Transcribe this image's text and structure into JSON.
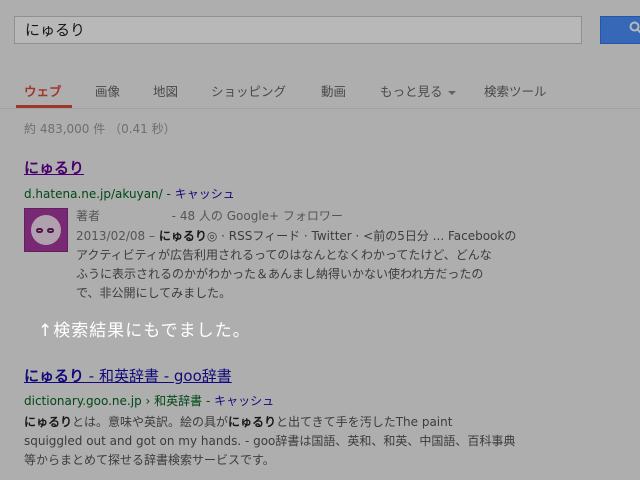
{
  "search": {
    "query": "にゅるり"
  },
  "tabs": [
    {
      "label": "ウェブ"
    },
    {
      "label": "画像"
    },
    {
      "label": "地図"
    },
    {
      "label": "ショッピング"
    },
    {
      "label": "動画"
    },
    {
      "label": "もっと見る"
    },
    {
      "label": "検索ツール"
    }
  ],
  "stats": "約 483,000 件 （0.41 秒）",
  "results": [
    {
      "title": "にゅるり",
      "url": "d.hatena.ne.jp/akuyan/",
      "cache": "キャッシュ",
      "author_label": "著者",
      "author_followers": "- 48 人の Google+ フォロワー",
      "snippet_lines": [
        {
          "date": "2013/02/08 –",
          "bold": "にゅるり",
          "text": "◎ · RSSフィード · Twitter · <前の5日分 ... Facebookの"
        },
        {
          "text": "アクティビティが広告利用されるってのはなんとなくわかってたけど、どんな"
        },
        {
          "text": "ふうに表示されるのかがわかった＆あんまし納得いかない使われ方だったの"
        },
        {
          "text": "で、非公開にしてみました。"
        }
      ]
    },
    {
      "title_bold": "にゅるり",
      "title_rest": " - 和英辞書 - goo辞書",
      "url": "dictionary.goo.ne.jp",
      "breadcrumb": "和英辞書",
      "cache": "キャッシュ",
      "snippet_lines": [
        {
          "bold": "にゅるり",
          "text": "とは。意味や英訳。絵の具が",
          "bold2": "にゅるり",
          "text2": "と出てきて手を汚したThe paint"
        },
        {
          "text": "squiggled out and got on my hands. - goo辞書は国語、英和、和英、中国語、百科事典"
        },
        {
          "text": "等からまとめて探せる辞書検索サービスです。"
        }
      ]
    }
  ],
  "annotation": "↑検索結果にもでました。",
  "colors": {
    "accent_red": "#dd4b39",
    "link_blue": "#1a0dab",
    "visited_purple": "#660099",
    "url_green": "#006621",
    "button_blue": "#4d90fe"
  }
}
